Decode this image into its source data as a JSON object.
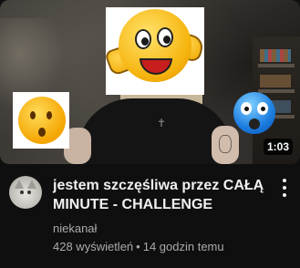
{
  "video": {
    "duration": "1:03",
    "title": "jestem szczęśliwa przez CAŁĄ MINUTE - CHALLENGE",
    "channel": "niekanał",
    "views": "428 wyświetleń",
    "separator": "•",
    "age": "14 godzin temu"
  },
  "thumbnail": {
    "stickers": [
      "thumbs-up-emoji",
      "worried-face-emoji",
      "blue-screaming-emoji"
    ]
  },
  "icons": {
    "menu": "more-vert-icon",
    "avatar": "cat-avatar"
  }
}
